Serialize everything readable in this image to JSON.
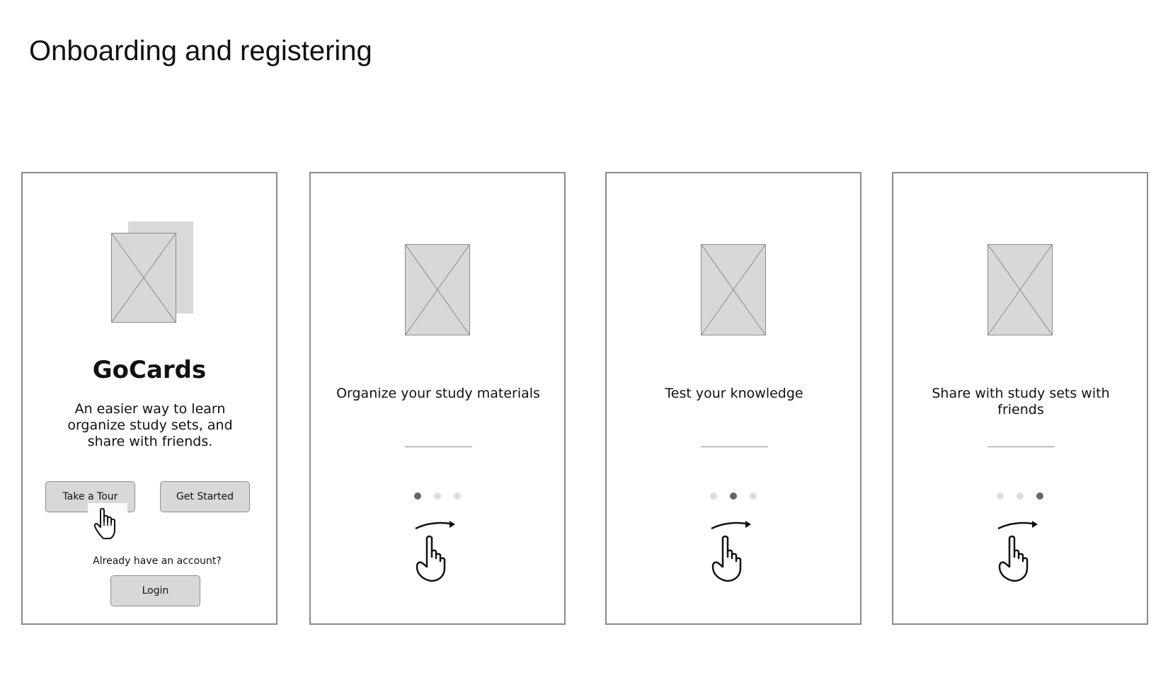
{
  "page": {
    "title": "Onboarding and registering"
  },
  "screens": [
    {
      "app_name": "GoCards",
      "tagline": "An easier way to learn organize study sets, and share with friends.",
      "take_tour_label": "Take a Tour",
      "get_started_label": "Get Started",
      "account_prompt": "Already have an account?",
      "login_label": "Login"
    },
    {
      "text": "Organize your study materials",
      "active_dot": 0
    },
    {
      "text": "Test your knowledge",
      "active_dot": 1
    },
    {
      "text": "Share with study sets with friends",
      "active_dot": 2
    }
  ],
  "colors": {
    "placeholder_fill": "#d8d8d8",
    "border": "#8a8a8a",
    "dot_active": "#666666",
    "dot_inactive": "#dddddd"
  },
  "icons": {
    "hero_image": "image-placeholder-icon",
    "cursor": "pointer-hand-cursor-icon",
    "swipe": "swipe-gesture-icon"
  }
}
